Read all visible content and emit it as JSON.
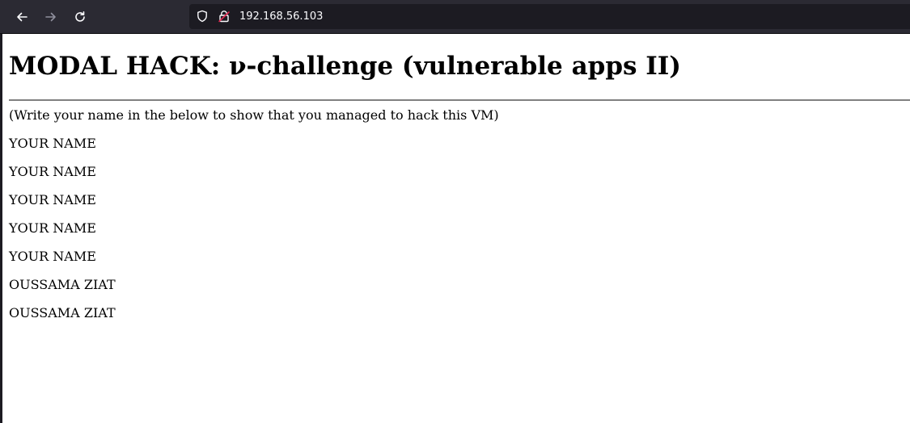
{
  "browser": {
    "url": "192.168.56.103",
    "toolbar_color": "#2b2a33",
    "icons": {
      "back": "arrow-left-icon",
      "forward": "arrow-right-icon",
      "reload": "reload-icon",
      "shield": "shield-icon",
      "lock": "insecure-lock-icon"
    }
  },
  "page": {
    "title": "MODAL HACK: ν-challenge (vulnerable apps II)",
    "instruction": "(Write your name in the below to show that you managed to hack this VM)",
    "names": [
      "YOUR NAME",
      "YOUR NAME",
      "YOUR NAME",
      "YOUR NAME",
      "YOUR NAME",
      "OUSSAMA ZIAT",
      "OUSSAMA ZIAT"
    ]
  }
}
